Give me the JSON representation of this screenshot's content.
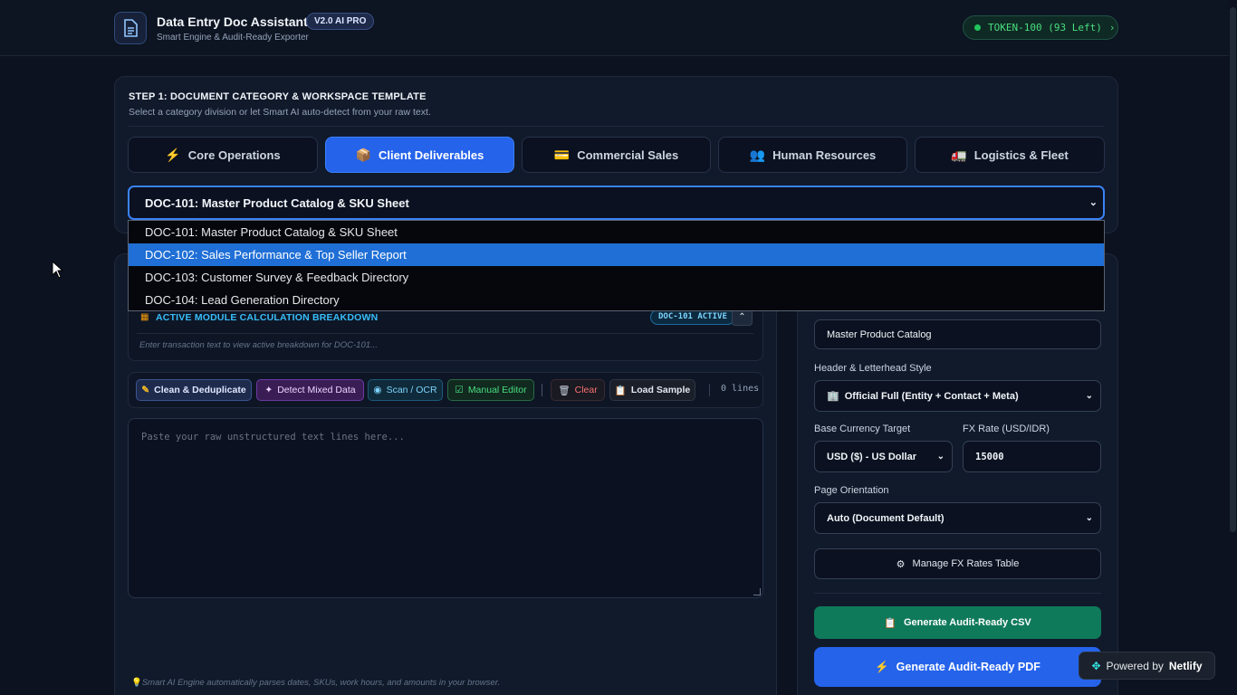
{
  "header": {
    "title": "Data Entry Doc Assistant",
    "version_badge": "V2.0 AI PRO",
    "subtitle": "Smart Engine & Audit-Ready Exporter",
    "token": "TOKEN-100 (93 Left)",
    "token_chevron": "›"
  },
  "step1": {
    "title": "STEP 1: DOCUMENT CATEGORY & WORKSPACE TEMPLATE",
    "subtitle": "Select a category division or let Smart AI auto-detect from your raw text.",
    "tabs": [
      {
        "label": "Core Operations",
        "icon": "⚡"
      },
      {
        "label": "Client Deliverables",
        "icon": "📦"
      },
      {
        "label": "Commercial Sales",
        "icon": "💳"
      },
      {
        "label": "Human Resources",
        "icon": "👥"
      },
      {
        "label": "Logistics & Fleet",
        "icon": "🚛"
      }
    ],
    "active_tab": "Client Deliverables",
    "template_select": {
      "selected": "DOC-101: Master Product Catalog & SKU Sheet",
      "options": [
        "DOC-101: Master Product Catalog & SKU Sheet",
        "DOC-102: Sales Performance & Top Seller Report",
        "DOC-103: Customer Survey & Feedback Directory",
        "DOC-104: Lead Generation Directory"
      ],
      "highlighted": "DOC-102: Sales Performance & Top Seller Report"
    }
  },
  "breakdown": {
    "title": "ACTIVE MODULE CALCULATION BREAKDOWN",
    "badge": "DOC-101 ACTIVE",
    "hint": "Enter transaction text to view active breakdown for DOC-101..."
  },
  "toolbar": {
    "clean": "Clean & Deduplicate",
    "detect": "Detect Mixed Data",
    "scan": "Scan / OCR",
    "manual": "Manual Editor",
    "clear": "Clear",
    "load": "Load Sample",
    "lines": "0 lines"
  },
  "raw_input": {
    "placeholder": "Paste your raw unstructured text lines here..."
  },
  "footnote": "Smart AI Engine automatically parses dates, SKUs, work hours, and amounts in your browser.",
  "settings": {
    "doc_title_value": "Master Product Catalog",
    "letterhead_label": "Header & Letterhead Style",
    "letterhead_value": "Official Full (Entity + Contact + Meta)",
    "currency_label": "Base Currency Target",
    "currency_value": "USD ($) - US Dollar",
    "fx_label": "FX Rate (USD/IDR)",
    "fx_value": "15000",
    "orientation_label": "Page Orientation",
    "orientation_value": "Auto (Document Default)",
    "manage_fx": "Manage FX Rates Table",
    "gen_csv": "Generate Audit-Ready CSV",
    "gen_pdf": "Generate Audit-Ready PDF"
  },
  "netlify": {
    "prefix": "Powered by",
    "brand": "Netlify"
  },
  "colors": {
    "background": "#0c1220",
    "accent": "#2563eb",
    "success": "#0f7a5a",
    "token_green": "#4ade80"
  }
}
